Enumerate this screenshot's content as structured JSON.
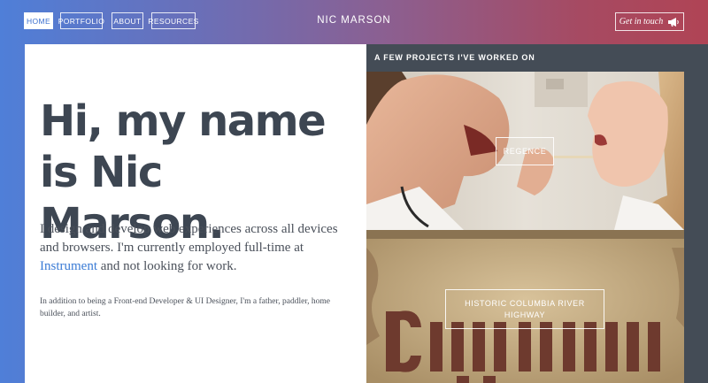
{
  "nav": {
    "items": [
      {
        "label": "Home",
        "active": true
      },
      {
        "label": "Portfolio",
        "active": false
      },
      {
        "label": "About",
        "active": false
      },
      {
        "label": "Resources",
        "active": false
      }
    ],
    "site_title": "Nic Marson",
    "contact_label": "Get in touch",
    "contact_icon": "megaphone-icon"
  },
  "intro": {
    "headline": "Hi, my name is Nic Marson.",
    "lead_before": "I design and develop web experiences across all devices and browsers. I'm currently employed full-time at ",
    "lead_link": "Instrument",
    "lead_after": " and not looking for work.",
    "small": "In addition to being a Front-end Developer & UI Designer, I'm a father, paddler, home builder, and artist."
  },
  "projects": {
    "title": "A few projects I've worked on",
    "items": [
      {
        "label": "Regence"
      },
      {
        "label": "Historic Columbia River Highway"
      }
    ]
  },
  "colors": {
    "gradient_start": "#4f7fd8",
    "gradient_end": "#b04455",
    "headline": "#3d4652",
    "link": "#3a7bd5",
    "projects_bg": "#444c56"
  }
}
